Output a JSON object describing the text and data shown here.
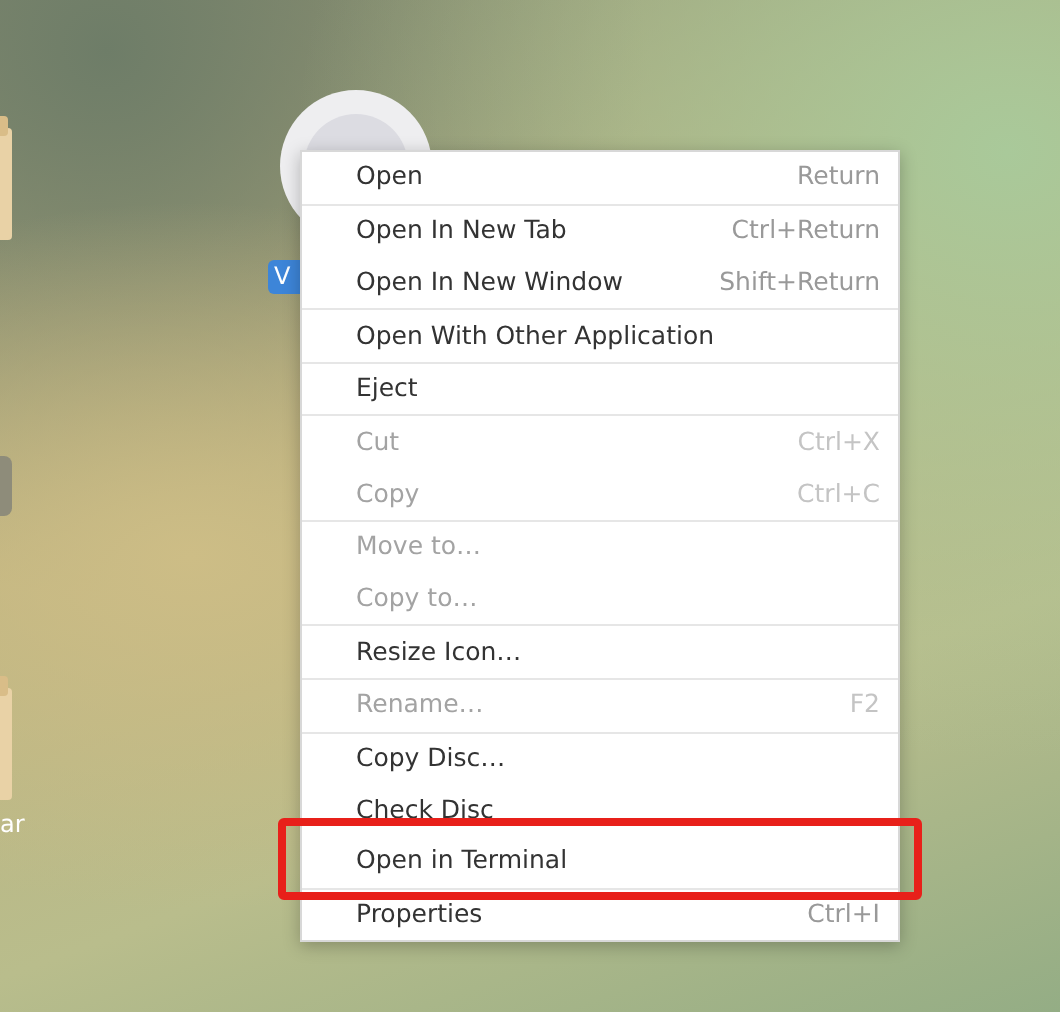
{
  "desktop_icons": [
    {
      "kind": "folder"
    },
    {
      "kind": "drive"
    },
    {
      "kind": "folder",
      "label": "ar",
      "selected": false
    },
    {
      "kind": "disc",
      "label": "V",
      "selected": true
    }
  ],
  "context_menu": {
    "sections": [
      [
        {
          "label": "Open",
          "shortcut": "Return",
          "disabled": false,
          "highlighted": false
        }
      ],
      [
        {
          "label": "Open In New Tab",
          "shortcut": "Ctrl+Return",
          "disabled": false,
          "highlighted": false
        },
        {
          "label": "Open In New Window",
          "shortcut": "Shift+Return",
          "disabled": false,
          "highlighted": false
        }
      ],
      [
        {
          "label": "Open With Other Application",
          "disabled": false,
          "highlighted": false
        }
      ],
      [
        {
          "label": "Eject",
          "disabled": false,
          "highlighted": false
        }
      ],
      [
        {
          "label": "Cut",
          "shortcut": "Ctrl+X",
          "disabled": true,
          "highlighted": false
        },
        {
          "label": "Copy",
          "shortcut": "Ctrl+C",
          "disabled": true,
          "highlighted": false
        }
      ],
      [
        {
          "label": "Move to…",
          "disabled": true,
          "highlighted": false
        },
        {
          "label": "Copy to…",
          "disabled": true,
          "highlighted": false
        }
      ],
      [
        {
          "label": "Resize Icon…",
          "disabled": false,
          "highlighted": false
        }
      ],
      [
        {
          "label": "Rename…",
          "shortcut": "F2",
          "disabled": true,
          "highlighted": false
        }
      ],
      [
        {
          "label": "Copy Disc…",
          "disabled": false,
          "highlighted": false
        },
        {
          "label": "Check Disc",
          "disabled": false,
          "highlighted": false
        },
        {
          "label": "Open in Terminal",
          "disabled": false,
          "highlighted": true
        }
      ],
      [
        {
          "label": "Properties",
          "shortcut": "Ctrl+I",
          "disabled": false,
          "highlighted": false
        }
      ]
    ]
  }
}
